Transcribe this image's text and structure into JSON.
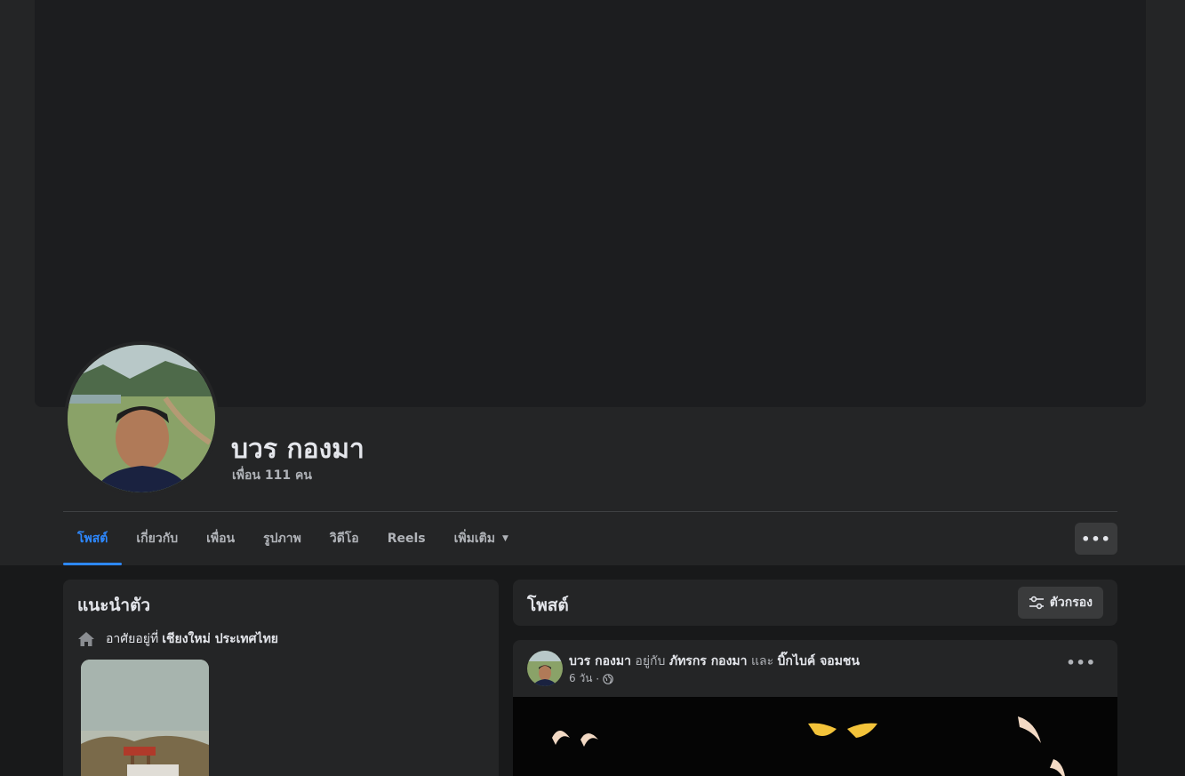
{
  "profile": {
    "name": "บวร กองมา",
    "friends": "เพื่อน 111 คน"
  },
  "tabs": [
    {
      "label": "โพสต์"
    },
    {
      "label": "เกี่ยวกับ"
    },
    {
      "label": "เพื่อน"
    },
    {
      "label": "รูปภาพ"
    },
    {
      "label": "วิดีโอ"
    },
    {
      "label": "Reels"
    },
    {
      "label": "เพิ่มเติม"
    }
  ],
  "more_button": {
    "icon": "more-horizontal-icon"
  },
  "intro": {
    "title": "แนะนำตัว",
    "home_prefix": "อาศัยอยู่ที่",
    "home_place": "เชียงใหม่ ประเทศไทย"
  },
  "posts": {
    "title": "โพสต์",
    "filter_label": "ตัวกรอง"
  },
  "post": {
    "author": "บวร กองมา",
    "with_text": "อยู่กับ",
    "tagged1": "ภัทรกร กองมา",
    "and_text": "และ",
    "tagged2": "บิ๊กไบค์ จอมชน",
    "time": "6 วัน"
  },
  "colors": {
    "accent": "#2d88ff",
    "background": "#18191a",
    "surface": "#242526"
  }
}
